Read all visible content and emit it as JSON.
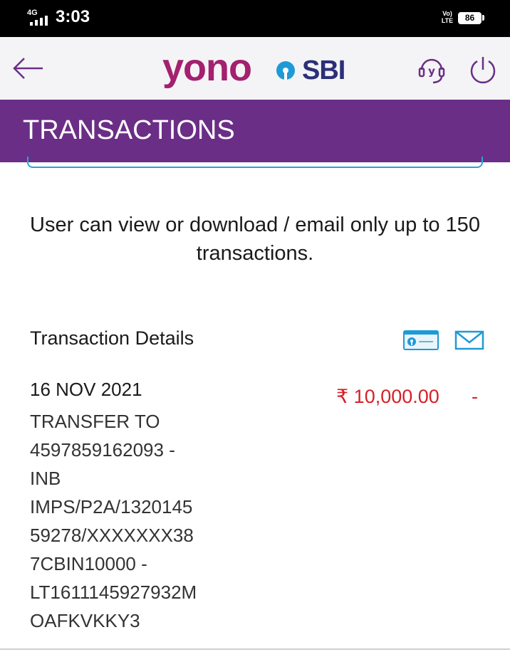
{
  "status_bar": {
    "network": "4G",
    "time": "3:03",
    "volte_line1": "Vo)",
    "volte_line2": "LTE",
    "battery": "86"
  },
  "app_bar": {
    "logo_primary": "yono",
    "logo_secondary": "SBI",
    "brand_color": "#a3216e",
    "sbi_color": "#2b2f7a",
    "icons": [
      "back-arrow-icon",
      "help-headset-icon",
      "power-icon"
    ]
  },
  "title_bar": {
    "title": "TRANSACTIONS",
    "color": "#6b2e86"
  },
  "notice": {
    "line1": "User can view or download / email only up to 150",
    "line2": "transactions."
  },
  "details": {
    "heading": "Transaction Details",
    "actions": [
      "passbook-icon",
      "email-icon"
    ]
  },
  "transaction": {
    "date": "16 NOV 2021",
    "description": "TRANSFER TO 4597859162093 - INB IMPS/P2A/132014559278/XXXXXXX387CBIN10000 - LT1611145927932MOAFKVKKY3",
    "desc_lines": [
      "TRANSFER TO",
      "4597859162093 -",
      "INB",
      "IMPS/P2A/1320145",
      "59278/XXXXXXX38",
      "7CBIN10000 -",
      "LT1611145927932M",
      "OAFKVKKY3"
    ],
    "amount": "₹ 10,000.00",
    "credit": "-",
    "amount_color": "#d61f26"
  }
}
